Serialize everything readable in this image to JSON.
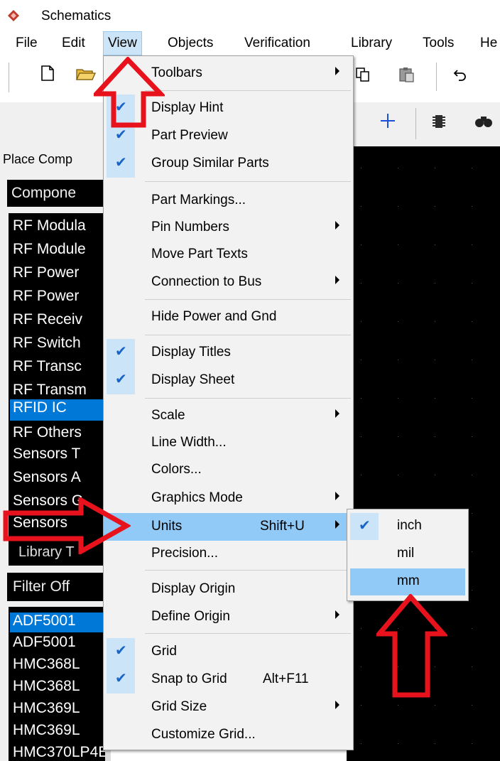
{
  "window": {
    "title": "Schematics"
  },
  "menubar": {
    "items": [
      {
        "label": "File"
      },
      {
        "label": "Edit"
      },
      {
        "label": "View"
      },
      {
        "label": "Objects"
      },
      {
        "label": "Verification"
      },
      {
        "label": "Library"
      },
      {
        "label": "Tools"
      },
      {
        "label": "He"
      }
    ]
  },
  "left_panel": {
    "place_label": "Place Comp",
    "component_header": "Compone",
    "components": [
      "RF Modula",
      "RF Module",
      "RF Power",
      "RF Power",
      "RF Receiv",
      "RF Switch",
      "RF Transc",
      "RF Transm",
      "RFID IC",
      "RF Others",
      "Sensors T",
      "Sensors A",
      "Sensors G",
      "Sensors"
    ],
    "selected_component": "RFID IC",
    "library_row": "Library T",
    "filter_header": "Filter Off",
    "parts": [
      "ADF5001",
      "ADF5001",
      "HMC368L",
      "HMC368L",
      "HMC369L",
      "HMC369L",
      "HMC370LP4E"
    ]
  },
  "view_menu": {
    "items": [
      {
        "label": "Toolbars",
        "submenu": true,
        "checked": false
      },
      {
        "label": "Display Hint",
        "checked": true
      },
      {
        "label": "Part Preview",
        "checked": true
      },
      {
        "label": "Group Similar Parts",
        "checked": true
      },
      {
        "label": "Part Markings...",
        "checked": false
      },
      {
        "label": "Pin Numbers",
        "submenu": true,
        "checked": false
      },
      {
        "label": "Move Part Texts",
        "checked": false
      },
      {
        "label": "Connection to Bus",
        "submenu": true,
        "checked": false
      },
      {
        "label": "Hide Power and Gnd",
        "checked": false
      },
      {
        "label": "Display Titles",
        "checked": true
      },
      {
        "label": "Display Sheet",
        "checked": true
      },
      {
        "label": "Scale",
        "submenu": true,
        "checked": false
      },
      {
        "label": "Line Width...",
        "checked": false
      },
      {
        "label": "Colors...",
        "checked": false
      },
      {
        "label": "Graphics Mode",
        "submenu": true,
        "checked": false
      },
      {
        "label": "Units",
        "shortcut": "Shift+U",
        "submenu": true,
        "highlighted": true
      },
      {
        "label": "Precision...",
        "checked": false
      },
      {
        "label": "Display Origin",
        "checked": false
      },
      {
        "label": "Define Origin",
        "submenu": true,
        "checked": false
      },
      {
        "label": "Grid",
        "checked": true
      },
      {
        "label": "Snap to Grid",
        "shortcut": "Alt+F11",
        "checked": true
      },
      {
        "label": "Grid Size",
        "submenu": true,
        "checked": false
      },
      {
        "label": "Customize Grid...",
        "checked": false
      }
    ]
  },
  "units_menu": {
    "items": [
      {
        "label": "inch",
        "checked": true
      },
      {
        "label": "mil",
        "checked": false
      },
      {
        "label": "mm",
        "highlighted": true
      }
    ]
  },
  "colors": {
    "check_bg": "#cce4f7",
    "highlight_bg": "#91c9f7",
    "annotation_arrow": "#e8121c",
    "selection": "#0078d7"
  }
}
